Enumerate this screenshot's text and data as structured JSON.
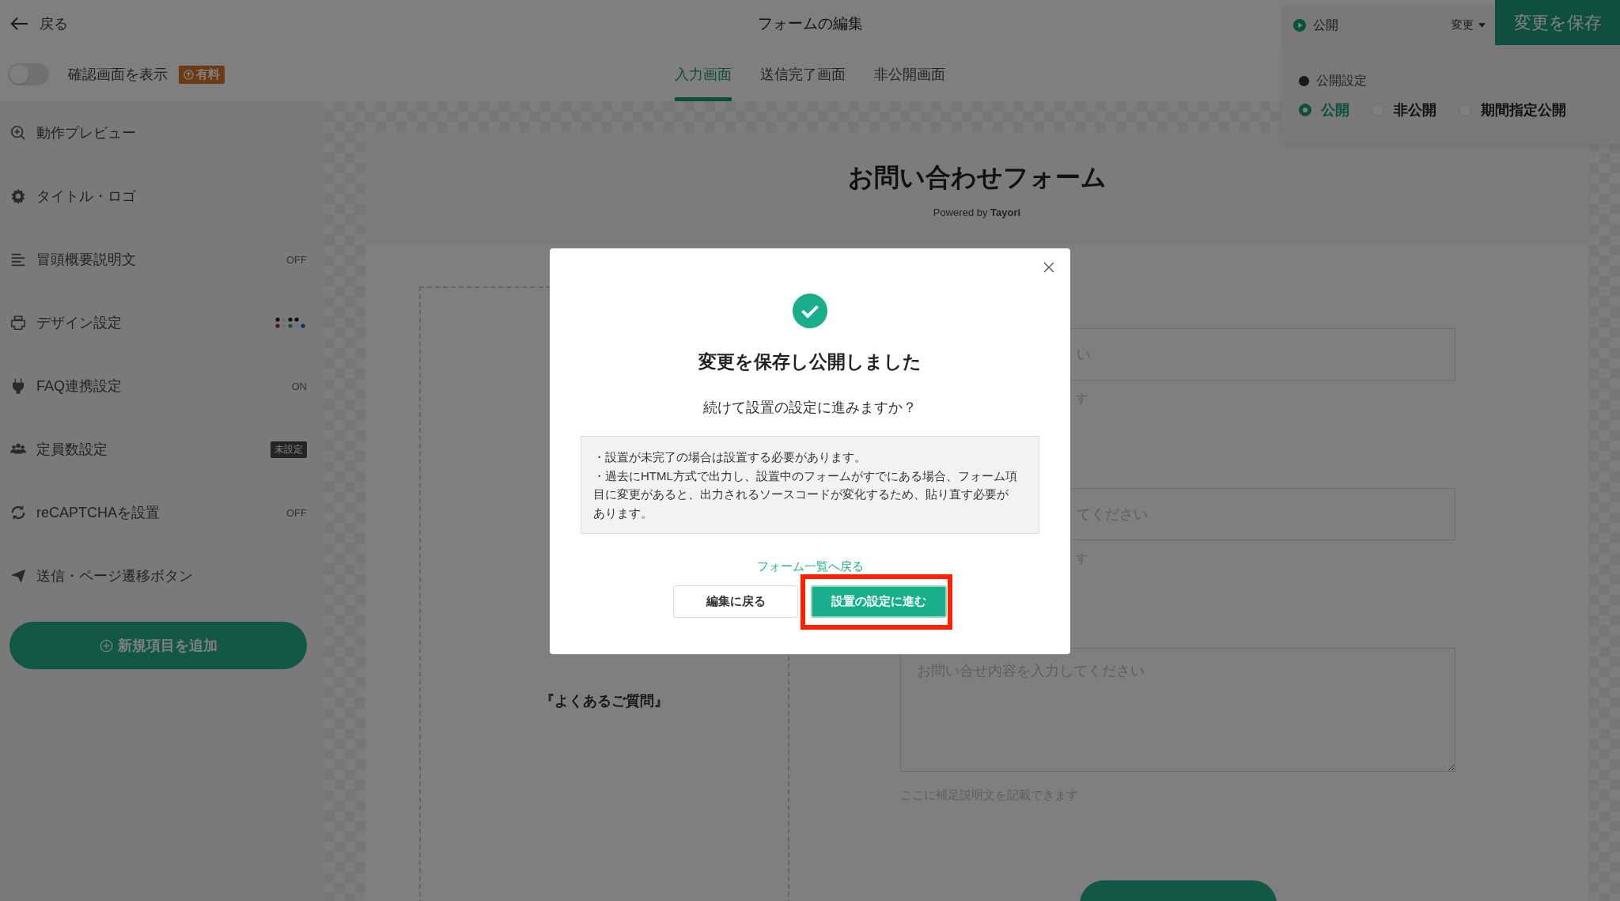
{
  "topbar": {
    "back": "戻る",
    "title": "フォームの編集",
    "status": "公開",
    "change": "変更",
    "save": "変更を保存"
  },
  "confirm_toggle": {
    "label": "確認画面を表示",
    "on": false,
    "badge": "有料"
  },
  "tabs": [
    {
      "label": "入力画面",
      "selected": true
    },
    {
      "label": "送信完了画面",
      "selected": false
    },
    {
      "label": "非公開画面",
      "selected": false
    }
  ],
  "publish_panel": {
    "heading": "公開設定",
    "options": [
      {
        "label": "公開",
        "selected": true
      },
      {
        "label": "非公開",
        "selected": false
      },
      {
        "label": "期間指定公開",
        "selected": false
      }
    ]
  },
  "sidebar": {
    "items": [
      {
        "label": "動作プレビュー"
      },
      {
        "label": "タイトル・ロゴ"
      },
      {
        "label": "冒頭概要説明文",
        "kind": "text",
        "value": "OFF"
      },
      {
        "label": "デザイン設定",
        "kind": "swatches"
      },
      {
        "label": "FAQ連携設定",
        "kind": "text",
        "value": "ON"
      },
      {
        "label": "定員数設定",
        "kind": "badge",
        "value": "未設定"
      },
      {
        "label": "reCAPTCHAを設置",
        "kind": "text",
        "value": "OFF"
      },
      {
        "label": "送信・ページ遷移ボタン"
      }
    ],
    "add_button": "新規項目を追加"
  },
  "form_preview": {
    "title": "お問い合わせフォーム",
    "powered_by": "Powered by **Tayori**",
    "faq_label": "『よくあるご質問』",
    "fields": [
      {
        "kind": "input",
        "placeholder": "い",
        "hint": "す"
      },
      {
        "kind": "input",
        "placeholder": "てください",
        "hint": "す"
      },
      {
        "kind": "textarea",
        "placeholder": "お問い合せ内容を入力してください",
        "hint": "ここに補足説明文を記載できます"
      }
    ]
  },
  "dialog": {
    "title": "変更を保存し公開しました",
    "question": "続けて設置の設定に進みますか？",
    "notes": [
      "・設置が未完了の場合は設置する必要があります。",
      "・過去にHTML方式で出力し、設置中のフォームがすでにある場合、フォーム項目に変更があると、出力されるソースコードが変化するため、貼り直す必要があります。"
    ],
    "link": "フォーム一覧へ戻る",
    "buttons": [
      {
        "label": "編集に戻る",
        "kind": "secondary",
        "highlighted": false
      },
      {
        "label": "設置の設定に進む",
        "kind": "primary",
        "highlighted": true
      }
    ]
  }
}
